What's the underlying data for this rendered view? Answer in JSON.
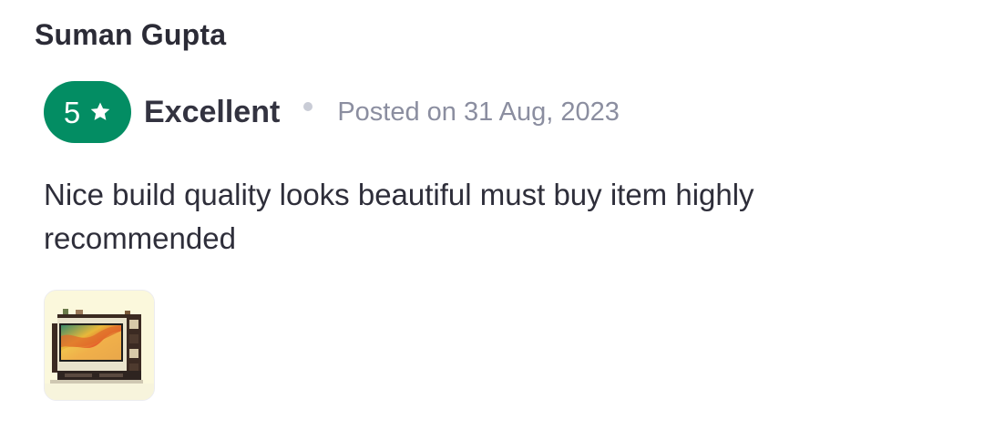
{
  "review": {
    "reviewer_name": "Suman Gupta",
    "rating": {
      "value": "5",
      "icon": "star-icon",
      "label": "Excellent",
      "badge_color": "#038d63"
    },
    "posted": "Posted on 31 Aug, 2023",
    "text": "Nice build quality looks beautiful must buy item highly recommended",
    "images": [
      {
        "icon": "tv-unit-product-photo"
      }
    ]
  }
}
